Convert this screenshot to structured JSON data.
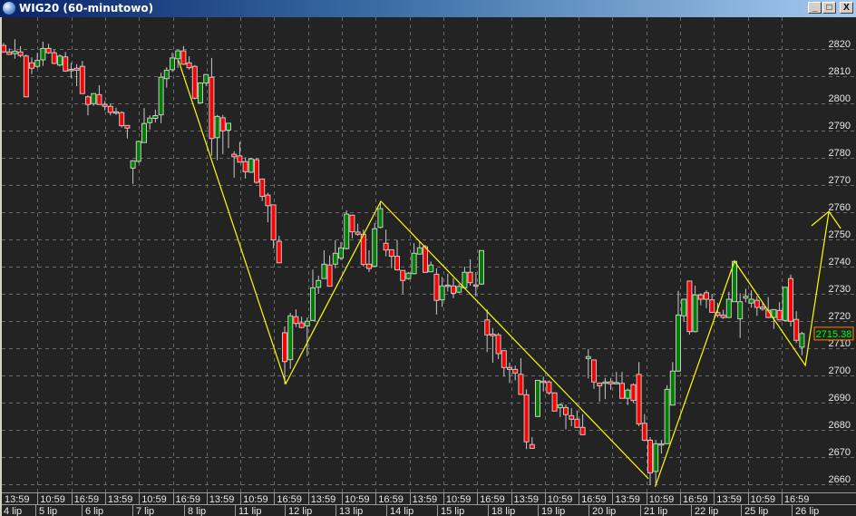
{
  "window": {
    "title": "WIG20 (60-minutowo)",
    "buttons": {
      "minimize": "_",
      "maximize": "□",
      "close": "X"
    }
  },
  "colors": {
    "background": "#232323",
    "grid": "#6a6a6a",
    "up": "#008000",
    "down": "#ff0000",
    "wick": "#c8c8c8",
    "zigzag": "#ffff00",
    "axis_text": "#e8e8e8",
    "last_price_text": "#00ff00",
    "last_price_border": "#ff8000"
  },
  "chart_data": {
    "type": "candlestick",
    "title": "WIG20 (60-minutowo)",
    "ylim": [
      2657,
      2826
    ],
    "grid": true,
    "y_ticks": [
      2820,
      2810,
      2800,
      2790,
      2780,
      2770,
      2760,
      2750,
      2740,
      2730,
      2720,
      2710,
      2700,
      2690,
      2680,
      2670,
      2660
    ],
    "last_price": "2715.38",
    "time_labels": [
      "13:59",
      "10:59",
      "16:59",
      "13:59",
      "10:59",
      "16:59",
      "13:59",
      "10:59",
      "16:59",
      "13:59",
      "10:59",
      "16:59",
      "13:59",
      "10:59",
      "16:59",
      "13:59",
      "10:59",
      "16:59",
      "13:59",
      "10:59",
      "16:59",
      "13:59",
      "10:59",
      "16:59"
    ],
    "date_labels": [
      "4 lip",
      "5 lip",
      "6 lip",
      "7 lip",
      "8 lip",
      "11 lip",
      "12 lip",
      "13 lip",
      "14 lip",
      "15 lip",
      "18 lip",
      "19 lip",
      "20 lip",
      "21 lip",
      "22 lip",
      "25 lip",
      "26 lip"
    ],
    "ohlc_fields": [
      "open",
      "high",
      "low",
      "close"
    ],
    "candles": [
      [
        2821.3,
        2822.2,
        2818.6,
        2818.9
      ],
      [
        2818.9,
        2820.2,
        2817.9,
        2818.0
      ],
      [
        2818.3,
        2823.6,
        2816.4,
        2819.2
      ],
      [
        2818.9,
        2821.0,
        2816.9,
        2817.6
      ],
      [
        2817.4,
        2818.0,
        2802.4,
        2802.4
      ],
      [
        2814.9,
        2816.9,
        2810.8,
        2812.9
      ],
      [
        2813.6,
        2818.6,
        2813.0,
        2815.8
      ],
      [
        2816.0,
        2822.7,
        2813.8,
        2820.2
      ],
      [
        2820.2,
        2821.9,
        2818.2,
        2818.6
      ],
      [
        2818.6,
        2819.7,
        2814.4,
        2814.7
      ],
      [
        2814.1,
        2818.0,
        2813.6,
        2817.4
      ],
      [
        2817.1,
        2818.9,
        2811.6,
        2811.9
      ],
      [
        2812.5,
        2814.9,
        2809.3,
        2812.4
      ],
      [
        2812.9,
        2814.4,
        2806.3,
        2812.2
      ],
      [
        2813.6,
        2815.6,
        2803.6,
        2803.6
      ],
      [
        2802.4,
        2803.0,
        2795.6,
        2799.6
      ],
      [
        2799.9,
        2803.8,
        2799.1,
        2803.6
      ],
      [
        2803.2,
        2806.7,
        2799.6,
        2799.6
      ],
      [
        2799.6,
        2800.8,
        2797.4,
        2798.9
      ],
      [
        2798.9,
        2800.0,
        2795.6,
        2796.7
      ],
      [
        2796.9,
        2798.4,
        2795.8,
        2796.7
      ],
      [
        2796.6,
        2797.1,
        2791.1,
        2791.8
      ],
      [
        2791.9,
        2791.9,
        2787.1,
        2790.9
      ],
      [
        2776.2,
        2779.1,
        2770.4,
        2778.9
      ],
      [
        2778.7,
        2786.3,
        2778.2,
        2786.0
      ],
      [
        2785.6,
        2798.3,
        2785.6,
        2792.6
      ],
      [
        2792.9,
        2795.6,
        2790.4,
        2794.6
      ],
      [
        2794.5,
        2797.7,
        2793.0,
        2795.5
      ],
      [
        2795.8,
        2811.3,
        2792.7,
        2809.6
      ],
      [
        2809.1,
        2813.3,
        2805.8,
        2812.2
      ],
      [
        2812.4,
        2818.6,
        2811.6,
        2816.7
      ],
      [
        2816.4,
        2819.7,
        2813.0,
        2819.3
      ],
      [
        2819.3,
        2821.1,
        2814.1,
        2814.4
      ],
      [
        2814.9,
        2817.3,
        2812.4,
        2813.1
      ],
      [
        2813.6,
        2814.1,
        2801.4,
        2801.9
      ],
      [
        2800.2,
        2807.8,
        2800.0,
        2807.5
      ],
      [
        2807.5,
        2810.8,
        2806.3,
        2810.6
      ],
      [
        2809.6,
        2816.7,
        2780.8,
        2787.1
      ],
      [
        2787.4,
        2795.8,
        2779.1,
        2795.2
      ],
      [
        2794.7,
        2795.8,
        2781.3,
        2789.9
      ],
      [
        2790.2,
        2792.7,
        2783.6,
        2792.7
      ],
      [
        2781.3,
        2782.4,
        2772.7,
        2780.4
      ],
      [
        2780.7,
        2785.8,
        2778.4,
        2778.4
      ],
      [
        2778.6,
        2780.2,
        2772.4,
        2774.9
      ],
      [
        2774.7,
        2780.0,
        2774.4,
        2779.6
      ],
      [
        2779.3,
        2779.9,
        2770.4,
        2771.0
      ],
      [
        2772.2,
        2772.2,
        2764.1,
        2765.8
      ],
      [
        2766.3,
        2767.1,
        2756.3,
        2762.4
      ],
      [
        2762.7,
        2762.7,
        2746.7,
        2749.8
      ],
      [
        2749.3,
        2751.3,
        2741.4,
        2741.4
      ],
      [
        2715.7,
        2718.0,
        2696.7,
        2705.1
      ],
      [
        2705.8,
        2723.0,
        2702.4,
        2721.9
      ],
      [
        2721.6,
        2724.3,
        2717.8,
        2719.1
      ],
      [
        2719.3,
        2721.6,
        2717.4,
        2717.6
      ],
      [
        2718.2,
        2721.3,
        2707.1,
        2719.9
      ],
      [
        2720.2,
        2738.9,
        2720.2,
        2732.2
      ],
      [
        2732.4,
        2736.7,
        2730.0,
        2734.9
      ],
      [
        2735.6,
        2746.0,
        2735.6,
        2740.9
      ],
      [
        2740.6,
        2744.1,
        2732.8,
        2732.8
      ],
      [
        2740.9,
        2749.7,
        2739.4,
        2744.9
      ],
      [
        2743.1,
        2749.1,
        2742.4,
        2746.9
      ],
      [
        2746.6,
        2760.7,
        2746.3,
        2759.3
      ],
      [
        2758.9,
        2759.1,
        2750.4,
        2752.8
      ],
      [
        2752.7,
        2755.8,
        2751.3,
        2751.9
      ],
      [
        2751.9,
        2753.6,
        2740.0,
        2740.8
      ],
      [
        2740.9,
        2746.0,
        2738.0,
        2739.3
      ],
      [
        2740.1,
        2756.0,
        2740.0,
        2753.9
      ],
      [
        2754.4,
        2763.3,
        2754.1,
        2761.3
      ],
      [
        2748.6,
        2753.6,
        2743.8,
        2746.1
      ],
      [
        2746.2,
        2746.2,
        2739.4,
        2743.8
      ],
      [
        2743.8,
        2749.7,
        2738.6,
        2738.8
      ],
      [
        2738.6,
        2738.6,
        2730.0,
        2734.9
      ],
      [
        2735.6,
        2738.0,
        2735.2,
        2737.6
      ],
      [
        2737.4,
        2748.6,
        2737.1,
        2744.9
      ],
      [
        2744.6,
        2749.1,
        2744.4,
        2746.9
      ],
      [
        2747.3,
        2748.0,
        2737.9,
        2737.9
      ],
      [
        2738.1,
        2741.9,
        2738.0,
        2740.6
      ],
      [
        2737.2,
        2739.4,
        2722.4,
        2727.6
      ],
      [
        2727.8,
        2736.2,
        2725.2,
        2732.9
      ],
      [
        2733.0,
        2737.4,
        2730.8,
        2733.2
      ],
      [
        2732.9,
        2735.8,
        2728.4,
        2730.2
      ],
      [
        2730.6,
        2733.6,
        2730.2,
        2732.7
      ],
      [
        2732.2,
        2740.0,
        2731.9,
        2737.9
      ],
      [
        2737.9,
        2742.7,
        2733.0,
        2734.1
      ],
      [
        2733.3,
        2738.0,
        2729.1,
        2733.2
      ],
      [
        2733.6,
        2745.9,
        2733.3,
        2745.9
      ],
      [
        2720.4,
        2724.3,
        2708.6,
        2714.9
      ],
      [
        2715.2,
        2717.4,
        2704.7,
        2714.6
      ],
      [
        2714.9,
        2715.6,
        2706.0,
        2708.0
      ],
      [
        2709.1,
        2709.1,
        2699.6,
        2702.9
      ],
      [
        2702.9,
        2704.7,
        2697.2,
        2702.2
      ],
      [
        2702.2,
        2703.6,
        2698.2,
        2700.9
      ],
      [
        2700.4,
        2706.3,
        2693.0,
        2693.0
      ],
      [
        2692.9,
        2694.9,
        2672.9,
        2675.6
      ],
      [
        2674.6,
        2677.3,
        2673.2,
        2673.2
      ],
      [
        2684.9,
        2698.2,
        2684.7,
        2698.2
      ],
      [
        2697.9,
        2699.6,
        2694.1,
        2697.8
      ],
      [
        2697.6,
        2698.2,
        2692.9,
        2693.6
      ],
      [
        2693.6,
        2693.8,
        2686.9,
        2686.9
      ],
      [
        2688.1,
        2689.7,
        2684.7,
        2689.2
      ],
      [
        2688.2,
        2689.3,
        2680.2,
        2685.6
      ],
      [
        2685.2,
        2688.0,
        2681.3,
        2683.9
      ],
      [
        2683.9,
        2687.1,
        2680.9,
        2680.9
      ],
      [
        2680.9,
        2685.8,
        2678.2,
        2678.2
      ],
      [
        2706.2,
        2709.7,
        2698.9,
        2706.9
      ],
      [
        2705.7,
        2705.7,
        2695.1,
        2697.6
      ],
      [
        2697.2,
        2697.2,
        2690.4,
        2696.2
      ],
      [
        2697.1,
        2699.1,
        2691.3,
        2697.6
      ],
      [
        2697.6,
        2699.1,
        2694.7,
        2696.9
      ],
      [
        2697.3,
        2701.3,
        2696.9,
        2697.4
      ],
      [
        2697.1,
        2701.3,
        2691.6,
        2691.6
      ],
      [
        2691.6,
        2695.2,
        2689.1,
        2694.6
      ],
      [
        2696.6,
        2697.1,
        2690.0,
        2690.8
      ],
      [
        2700.4,
        2704.9,
        2681.3,
        2682.2
      ],
      [
        2682.4,
        2685.8,
        2675.8,
        2676.2
      ],
      [
        2676.2,
        2677.3,
        2659.7,
        2664.2
      ],
      [
        2664.7,
        2676.3,
        2660.2,
        2674.9
      ],
      [
        2674.8,
        2676.3,
        2671.3,
        2674.9
      ],
      [
        2674.9,
        2696.4,
        2674.7,
        2694.9
      ],
      [
        2689.1,
        2704.9,
        2689.1,
        2701.6
      ],
      [
        2701.6,
        2731.1,
        2701.3,
        2722.2
      ],
      [
        2721.9,
        2728.0,
        2719.7,
        2728.0
      ],
      [
        2734.7,
        2734.7,
        2715.0,
        2716.1
      ],
      [
        2716.1,
        2733.0,
        2715.8,
        2729.6
      ],
      [
        2729.6,
        2730.2,
        2725.8,
        2728.0
      ],
      [
        2730.4,
        2731.3,
        2724.7,
        2728.0
      ],
      [
        2727.8,
        2730.0,
        2723.0,
        2723.2
      ],
      [
        2723.1,
        2726.7,
        2721.3,
        2722.1
      ],
      [
        2722.2,
        2724.1,
        2720.8,
        2721.3
      ],
      [
        2721.3,
        2730.8,
        2721.1,
        2728.0
      ],
      [
        2727.1,
        2742.4,
        2727.1,
        2741.9
      ],
      [
        2720.8,
        2730.2,
        2713.8,
        2727.1
      ],
      [
        2728.4,
        2731.9,
        2726.9,
        2729.1
      ],
      [
        2726.6,
        2731.3,
        2724.9,
        2728.0
      ],
      [
        2727.6,
        2729.1,
        2721.9,
        2725.0
      ],
      [
        2725.1,
        2726.9,
        2723.8,
        2724.4
      ],
      [
        2724.0,
        2728.8,
        2721.1,
        2721.3
      ],
      [
        2721.3,
        2724.2,
        2717.1,
        2724.2
      ],
      [
        2723.9,
        2726.9,
        2720.2,
        2720.4
      ],
      [
        2720.2,
        2732.4,
        2719.7,
        2732.4
      ],
      [
        2735.6,
        2737.1,
        2718.0,
        2719.9
      ],
      [
        2720.6,
        2723.6,
        2711.9,
        2712.9
      ],
      [
        2710.4,
        2716.0,
        2707.4,
        2715.38
      ]
    ],
    "zigzag": [
      {
        "points": [
          {
            "bar": 32.1,
            "price": 2815.8
          },
          {
            "bar": 51.2,
            "price": 2697.0
          },
          {
            "bar": 68.1,
            "price": 2764.0
          },
          {
            "bar": 115.7,
            "price": 2662.0
          }
        ]
      },
      {
        "points": [
          {
            "bar": 116.9,
            "price": 2659.1
          },
          {
            "bar": 131.0,
            "price": 2742.0
          },
          {
            "bar": 143.6,
            "price": 2703.7
          },
          {
            "bar": 147.8,
            "price": 2760.3
          }
        ]
      },
      {
        "points": [
          {
            "bar": 144.7,
            "price": 2755.0
          },
          {
            "bar": 147.8,
            "price": 2760.3
          },
          {
            "bar": 149.9,
            "price": 2754.0
          }
        ]
      }
    ]
  }
}
